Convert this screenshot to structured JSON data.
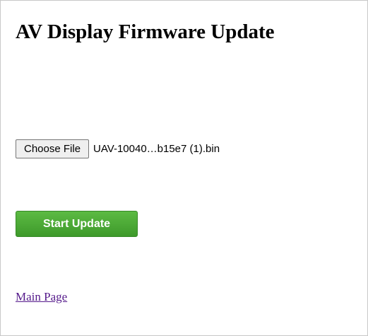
{
  "page": {
    "title": "AV Display Firmware Update"
  },
  "file_input": {
    "button_label": "Choose File",
    "selected_file": "UAV-10040…b15e7 (1).bin"
  },
  "actions": {
    "start_update_label": "Start Update"
  },
  "links": {
    "main_page_label": "Main Page"
  },
  "colors": {
    "start_button": "#4caf36",
    "visited_link": "#551a8b"
  }
}
